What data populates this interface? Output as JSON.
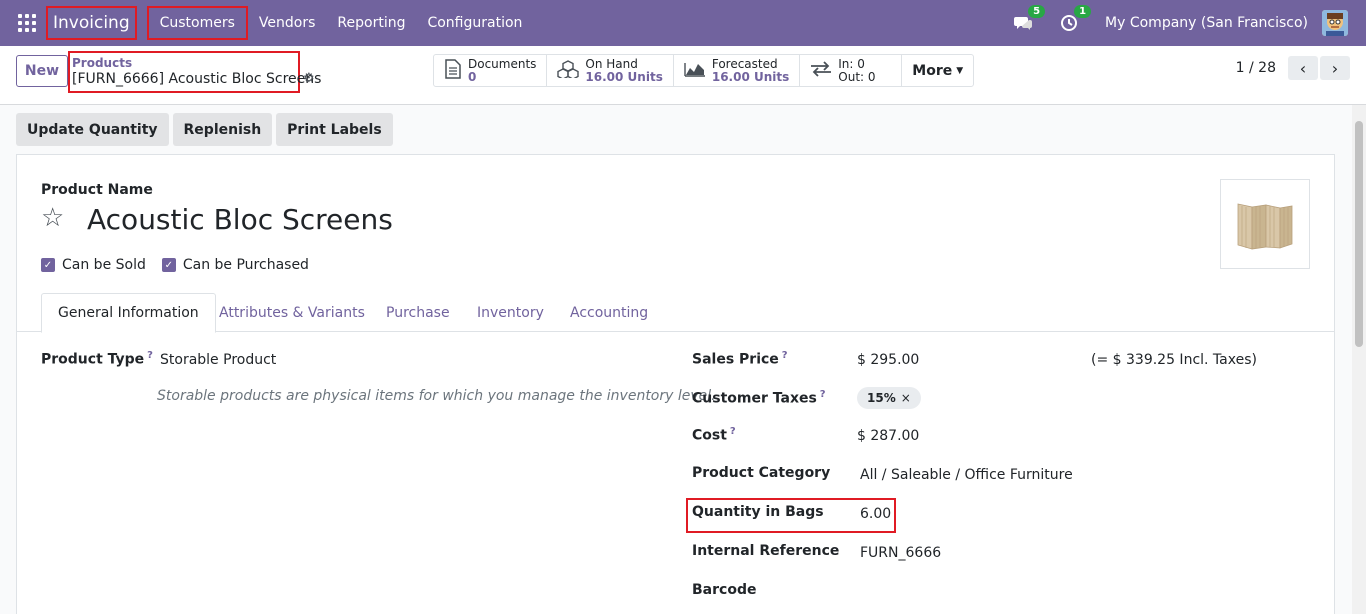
{
  "navbar": {
    "app_name": "Invoicing",
    "menu": [
      "Customers",
      "Vendors",
      "Reporting",
      "Configuration"
    ],
    "messages_count": "5",
    "activities_count": "1",
    "company": "My Company (San Francisco)"
  },
  "control": {
    "new_label": "New",
    "breadcrumb_parent": "Products",
    "breadcrumb_current": "[FURN_6666] Acoustic Bloc Screens",
    "stats": {
      "documents_label": "Documents",
      "documents_value": "0",
      "onhand_label": "On Hand",
      "onhand_value": "16.00 Units",
      "forecasted_label": "Forecasted",
      "forecasted_value": "16.00 Units",
      "in_label": "In: 0",
      "out_label": "Out: 0",
      "more_label": "More"
    },
    "pager": "1 / 28"
  },
  "actions": [
    "Update Quantity",
    "Replenish",
    "Print Labels"
  ],
  "form": {
    "product_name_label": "Product Name",
    "product_name": "Acoustic Bloc Screens",
    "can_be_sold": "Can be Sold",
    "can_be_purchased": "Can be Purchased",
    "tabs": [
      "General Information",
      "Attributes & Variants",
      "Purchase",
      "Inventory",
      "Accounting"
    ],
    "product_type_label": "Product Type",
    "product_type_value": "Storable Product",
    "product_type_help": "Storable products are physical items for which you manage the inventory level.",
    "sales_price_label": "Sales Price",
    "sales_price_value": "$ 295.00",
    "sales_price_incl": "(= $ 339.25 Incl. Taxes)",
    "customer_taxes_label": "Customer Taxes",
    "customer_taxes_tag": "15%",
    "cost_label": "Cost",
    "cost_value": "$ 287.00",
    "category_label": "Product Category",
    "category_value": "All / Saleable / Office Furniture",
    "qty_bags_label": "Quantity in Bags",
    "qty_bags_value": "6.00",
    "internal_ref_label": "Internal Reference",
    "internal_ref_value": "FURN_6666",
    "barcode_label": "Barcode"
  },
  "colors": {
    "brand": "#71639e",
    "highlight": "#e01b24"
  }
}
